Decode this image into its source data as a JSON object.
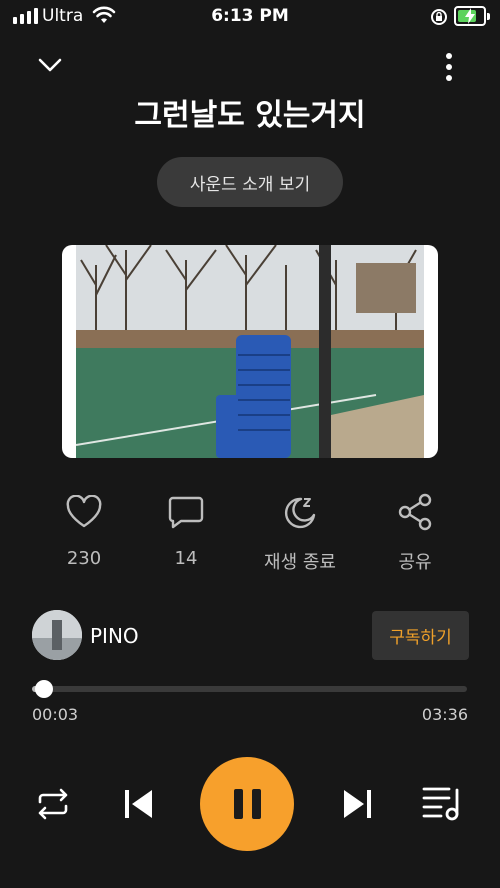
{
  "status_bar": {
    "carrier": "Ultra",
    "time": "6:13 PM",
    "icons": [
      "signal-icon",
      "wifi-icon",
      "orientation-lock-icon",
      "battery-charging-icon"
    ],
    "battery_color": "#5dd35d"
  },
  "nav": {
    "icons": [
      "chevron-down-icon",
      "more-vertical-icon"
    ]
  },
  "track": {
    "title": "그런날도 있는거지",
    "sound_intro_label": "사운드 소개 보기"
  },
  "actions": [
    {
      "icon": "heart-icon",
      "label": "230"
    },
    {
      "icon": "comment-icon",
      "label": "14"
    },
    {
      "icon": "sleep-timer-icon",
      "label": "재생 종료"
    },
    {
      "icon": "share-icon",
      "label": "공유"
    }
  ],
  "creator": {
    "name": "PINO",
    "subscribe_label": "구독하기"
  },
  "playback": {
    "current_time": "00:03",
    "total_time": "03:36",
    "progress": 0.014
  },
  "controls": [
    "repeat-icon",
    "previous-icon",
    "pause-icon",
    "next-icon",
    "playlist-icon"
  ],
  "colors": {
    "accent": "#f7a02c",
    "background": "#171717",
    "subscribe_text": "#f0a12a"
  }
}
